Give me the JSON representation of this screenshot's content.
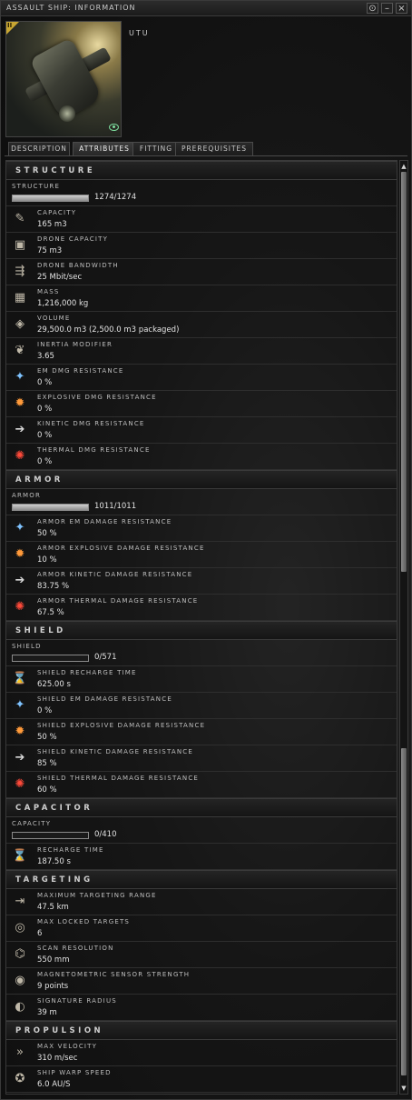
{
  "window": {
    "title": "ASSAULT SHIP: INFORMATION",
    "buttons": {
      "options": "⊙",
      "minimize": "–",
      "close": "×"
    }
  },
  "ship": {
    "name": "UTU",
    "corner_label": "II"
  },
  "tabs": [
    {
      "label": "DESCRIPTION",
      "active": false
    },
    {
      "label": "ATTRIBUTES",
      "active": true
    },
    {
      "label": "FITTING",
      "active": false
    },
    {
      "label": "PREREQUISITES",
      "active": false
    }
  ],
  "sections": {
    "structure": "STRUCTURE",
    "armor": "ARMOR",
    "shield": "SHIELD",
    "capacitor": "CAPACITOR",
    "targeting": "TARGETING",
    "propulsion": "PROPULSION"
  },
  "bars": {
    "structure": {
      "label": "STRUCTURE",
      "value": "1274/1274",
      "fill": 1.0
    },
    "armor": {
      "label": "ARMOR",
      "value": "1011/1011",
      "fill": 1.0
    },
    "shield": {
      "label": "SHIELD",
      "value": "0/571",
      "fill": 0.0
    },
    "capacitor": {
      "label": "CAPACITY",
      "value": "0/410",
      "fill": 0.0
    }
  },
  "attributes": {
    "structure": [
      {
        "icon": "capacity-icon",
        "label": "CAPACITY",
        "value": "165 m3"
      },
      {
        "icon": "drone-capacity-icon",
        "label": "DRONE CAPACITY",
        "value": "75 m3"
      },
      {
        "icon": "drone-bandwidth-icon",
        "label": "DRONE BANDWIDTH",
        "value": "25 Mbit/sec"
      },
      {
        "icon": "mass-icon",
        "label": "MASS",
        "value": "1,216,000 kg"
      },
      {
        "icon": "volume-icon",
        "label": "VOLUME",
        "value": "29,500.0 m3 (2,500.0 m3 packaged)"
      },
      {
        "icon": "inertia-icon",
        "label": "INERTIA MODIFIER",
        "value": "3.65"
      },
      {
        "icon": "em-resistance-icon",
        "label": "EM DMG RESISTANCE",
        "value": "0 %"
      },
      {
        "icon": "explosive-resistance-icon",
        "label": "EXPLOSIVE DMG RESISTANCE",
        "value": "0 %"
      },
      {
        "icon": "kinetic-resistance-icon",
        "label": "KINETIC DMG RESISTANCE",
        "value": "0 %"
      },
      {
        "icon": "thermal-resistance-icon",
        "label": "THERMAL DMG RESISTANCE",
        "value": "0 %"
      }
    ],
    "armor": [
      {
        "icon": "em-resistance-icon",
        "label": "ARMOR EM DAMAGE RESISTANCE",
        "value": "50 %"
      },
      {
        "icon": "explosive-resistance-icon",
        "label": "ARMOR EXPLOSIVE DAMAGE RESISTANCE",
        "value": "10 %"
      },
      {
        "icon": "kinetic-resistance-icon",
        "label": "ARMOR KINETIC DAMAGE RESISTANCE",
        "value": "83.75 %"
      },
      {
        "icon": "thermal-resistance-icon",
        "label": "ARMOR THERMAL DAMAGE RESISTANCE",
        "value": "67.5 %"
      }
    ],
    "shield": [
      {
        "icon": "hourglass-icon",
        "label": "SHIELD RECHARGE TIME",
        "value": "625.00 s"
      },
      {
        "icon": "em-resistance-icon",
        "label": "SHIELD EM DAMAGE RESISTANCE",
        "value": "0 %"
      },
      {
        "icon": "explosive-resistance-icon",
        "label": "SHIELD EXPLOSIVE DAMAGE RESISTANCE",
        "value": "50 %"
      },
      {
        "icon": "kinetic-resistance-icon",
        "label": "SHIELD KINETIC DAMAGE RESISTANCE",
        "value": "85 %"
      },
      {
        "icon": "thermal-resistance-icon",
        "label": "SHIELD THERMAL DAMAGE RESISTANCE",
        "value": "60 %"
      }
    ],
    "capacitor": [
      {
        "icon": "hourglass-icon",
        "label": "RECHARGE TIME",
        "value": "187.50 s"
      }
    ],
    "targeting": [
      {
        "icon": "targeting-range-icon",
        "label": "MAXIMUM TARGETING RANGE",
        "value": "47.5 km"
      },
      {
        "icon": "locked-targets-icon",
        "label": "MAX LOCKED TARGETS",
        "value": "6"
      },
      {
        "icon": "scan-resolution-icon",
        "label": "SCAN RESOLUTION",
        "value": "550 mm"
      },
      {
        "icon": "sensor-strength-icon",
        "label": "MAGNETOMETRIC SENSOR STRENGTH",
        "value": "9 points"
      },
      {
        "icon": "signature-radius-icon",
        "label": "SIGNATURE RADIUS",
        "value": "39 m"
      }
    ],
    "propulsion": [
      {
        "icon": "velocity-icon",
        "label": "MAX VELOCITY",
        "value": "310 m/sec"
      },
      {
        "icon": "warp-speed-icon",
        "label": "SHIP WARP SPEED",
        "value": "6.0 AU/S"
      }
    ]
  },
  "scrollbar": {
    "up": "▲",
    "down": "▼"
  }
}
